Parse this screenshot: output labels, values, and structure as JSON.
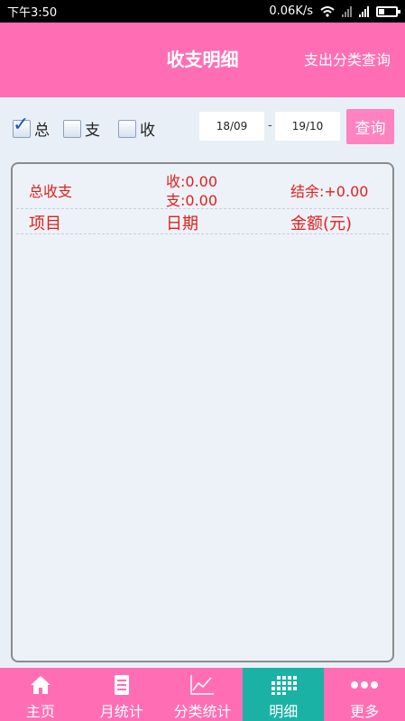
{
  "status": {
    "time": "下午3:50",
    "speed": "0.06K/s"
  },
  "header": {
    "title": "收支明细",
    "link": "支出分类查询"
  },
  "filter": {
    "checkboxes": [
      {
        "label": "总",
        "checked": true
      },
      {
        "label": "支",
        "checked": false
      },
      {
        "label": "收",
        "checked": false
      }
    ],
    "date_from": "18/09",
    "date_sep": "-",
    "date_to": "19/10",
    "query_label": "查询"
  },
  "summary": {
    "label": "总收支",
    "income": "收:0.00",
    "expense": "支:0.00",
    "balance": "结余:+0.00"
  },
  "columns": [
    "项目",
    "日期",
    "金额(元)"
  ],
  "tabs": [
    {
      "label": "主页",
      "icon": "home-icon",
      "active": false
    },
    {
      "label": "月统计",
      "icon": "document-icon",
      "active": false
    },
    {
      "label": "分类统计",
      "icon": "line-chart-icon",
      "active": false
    },
    {
      "label": "明细",
      "icon": "grid-calendar-icon",
      "active": true
    },
    {
      "label": "更多",
      "icon": "more-dots-icon",
      "active": false
    }
  ],
  "colors": {
    "brand_pink": "#ff6eb4",
    "active_tab": "#1ab2a4",
    "summary_red": "#e0201c"
  }
}
